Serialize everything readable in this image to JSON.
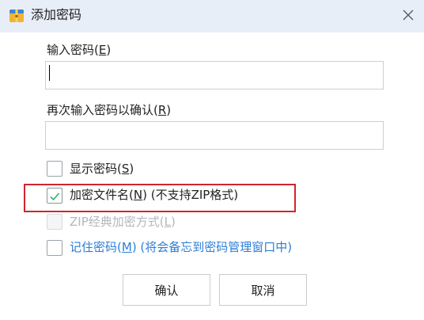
{
  "window": {
    "title": "添加密码"
  },
  "password": {
    "label": "输入密码(",
    "label_key": "E",
    "label_end": ")",
    "value": ""
  },
  "confirm": {
    "label": "再次输入密码以确认(",
    "label_key": "R",
    "label_end": ")",
    "value": ""
  },
  "options": {
    "show_password": {
      "label": "显示密码(",
      "key": "S",
      "end": ")",
      "checked": false,
      "enabled": true
    },
    "encrypt_filenames": {
      "label": "加密文件名(",
      "key": "N",
      "end": ") (不支持ZIP格式)",
      "checked": true,
      "enabled": true
    },
    "zip_classic": {
      "label": "ZIP经典加密方式(",
      "key": "L",
      "end": ")",
      "checked": false,
      "enabled": false
    },
    "remember_password": {
      "label": "记住密码(",
      "key": "M",
      "end": ") (将会备忘到密码管理窗口中)",
      "checked": false,
      "enabled": true
    }
  },
  "buttons": {
    "ok": "确认",
    "cancel": "取消"
  },
  "colors": {
    "titlebar": "#e8eef7",
    "highlight": "#d0252f",
    "link": "#2b7ed7",
    "check": "#29b56a",
    "disabled_text": "#b3b7bb"
  },
  "icons": {
    "app": "archive-icon",
    "close": "close-icon",
    "check": "checkmark-icon"
  }
}
